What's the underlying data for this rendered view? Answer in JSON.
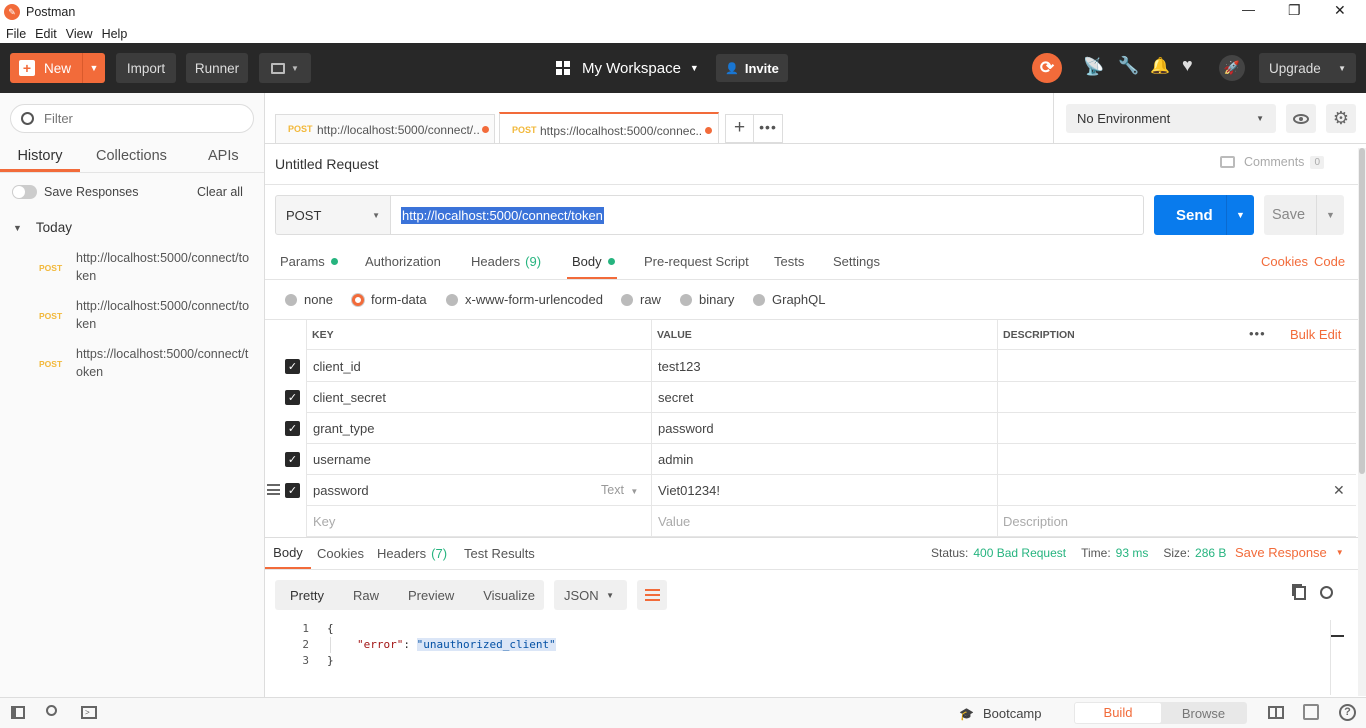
{
  "window": {
    "title": "Postman",
    "min_glyph": "—",
    "max_glyph": "❐",
    "close_glyph": "✕"
  },
  "menu": [
    "File",
    "Edit",
    "View",
    "Help"
  ],
  "header": {
    "new_label": "New",
    "import_label": "Import",
    "runner_label": "Runner",
    "workspace_label": "My Workspace",
    "invite_label": "Invite",
    "upgrade_label": "Upgrade",
    "accent": "#f26b3a"
  },
  "sidebar": {
    "filter_placeholder": "Filter",
    "tabs": [
      "History",
      "Collections",
      "APIs"
    ],
    "save_responses_label": "Save Responses",
    "clear_all_label": "Clear all",
    "group_label": "Today",
    "items": [
      {
        "method": "POST",
        "url": "http://localhost:5000/connect/token"
      },
      {
        "method": "POST",
        "url": "http://localhost:5000/connect/token"
      },
      {
        "method": "POST",
        "url": "https://localhost:5000/connect/token"
      }
    ]
  },
  "request_tabs": [
    {
      "method": "POST",
      "url": "http://localhost:5000/connect/..."
    },
    {
      "method": "POST",
      "url": "https://localhost:5000/connec..."
    }
  ],
  "environment": {
    "selected": "No Environment"
  },
  "request": {
    "name": "Untitled Request",
    "comments_label": "Comments",
    "comments_count": "0",
    "method": "POST",
    "url": "http://localhost:5000/connect/token",
    "send_label": "Send",
    "save_label": "Save"
  },
  "request_subtabs": [
    {
      "label": "Params"
    },
    {
      "label": "Authorization"
    },
    {
      "label": "Headers",
      "count": "(9)"
    },
    {
      "label": "Body"
    },
    {
      "label": "Pre-request Script"
    },
    {
      "label": "Tests"
    },
    {
      "label": "Settings"
    }
  ],
  "cookies_label": "Cookies",
  "code_label": "Code",
  "body_types": [
    "none",
    "form-data",
    "x-www-form-urlencoded",
    "raw",
    "binary",
    "GraphQL"
  ],
  "table": {
    "headers": {
      "key": "KEY",
      "value": "VALUE",
      "description": "DESCRIPTION"
    },
    "bulk_edit_label": "Bulk Edit",
    "rows": [
      {
        "key": "client_id",
        "value": "test123"
      },
      {
        "key": "client_secret",
        "value": "secret"
      },
      {
        "key": "grant_type",
        "value": "password"
      },
      {
        "key": "username",
        "value": "admin"
      },
      {
        "key": "password",
        "value": "Viet01234!",
        "type": "Text"
      }
    ],
    "placeholder": {
      "key": "Key",
      "value": "Value",
      "description": "Description"
    }
  },
  "response": {
    "tabs": [
      {
        "label": "Body"
      },
      {
        "label": "Cookies"
      },
      {
        "label": "Headers",
        "count": "(7)"
      },
      {
        "label": "Test Results"
      }
    ],
    "status_label": "Status:",
    "status_value": "400 Bad Request",
    "time_label": "Time:",
    "time_value": "93 ms",
    "size_label": "Size:",
    "size_value": "286 B",
    "save_response_label": "Save Response",
    "view_modes": [
      "Pretty",
      "Raw",
      "Preview",
      "Visualize"
    ],
    "format": "JSON",
    "lines": [
      "1",
      "2",
      "3"
    ],
    "code": {
      "open": "{",
      "key": "\"error\"",
      "colon": ": ",
      "value": "\"unauthorized_client\"",
      "close": "}"
    }
  },
  "statusbar": {
    "bootcamp_label": "Bootcamp",
    "build_label": "Build",
    "browse_label": "Browse"
  }
}
